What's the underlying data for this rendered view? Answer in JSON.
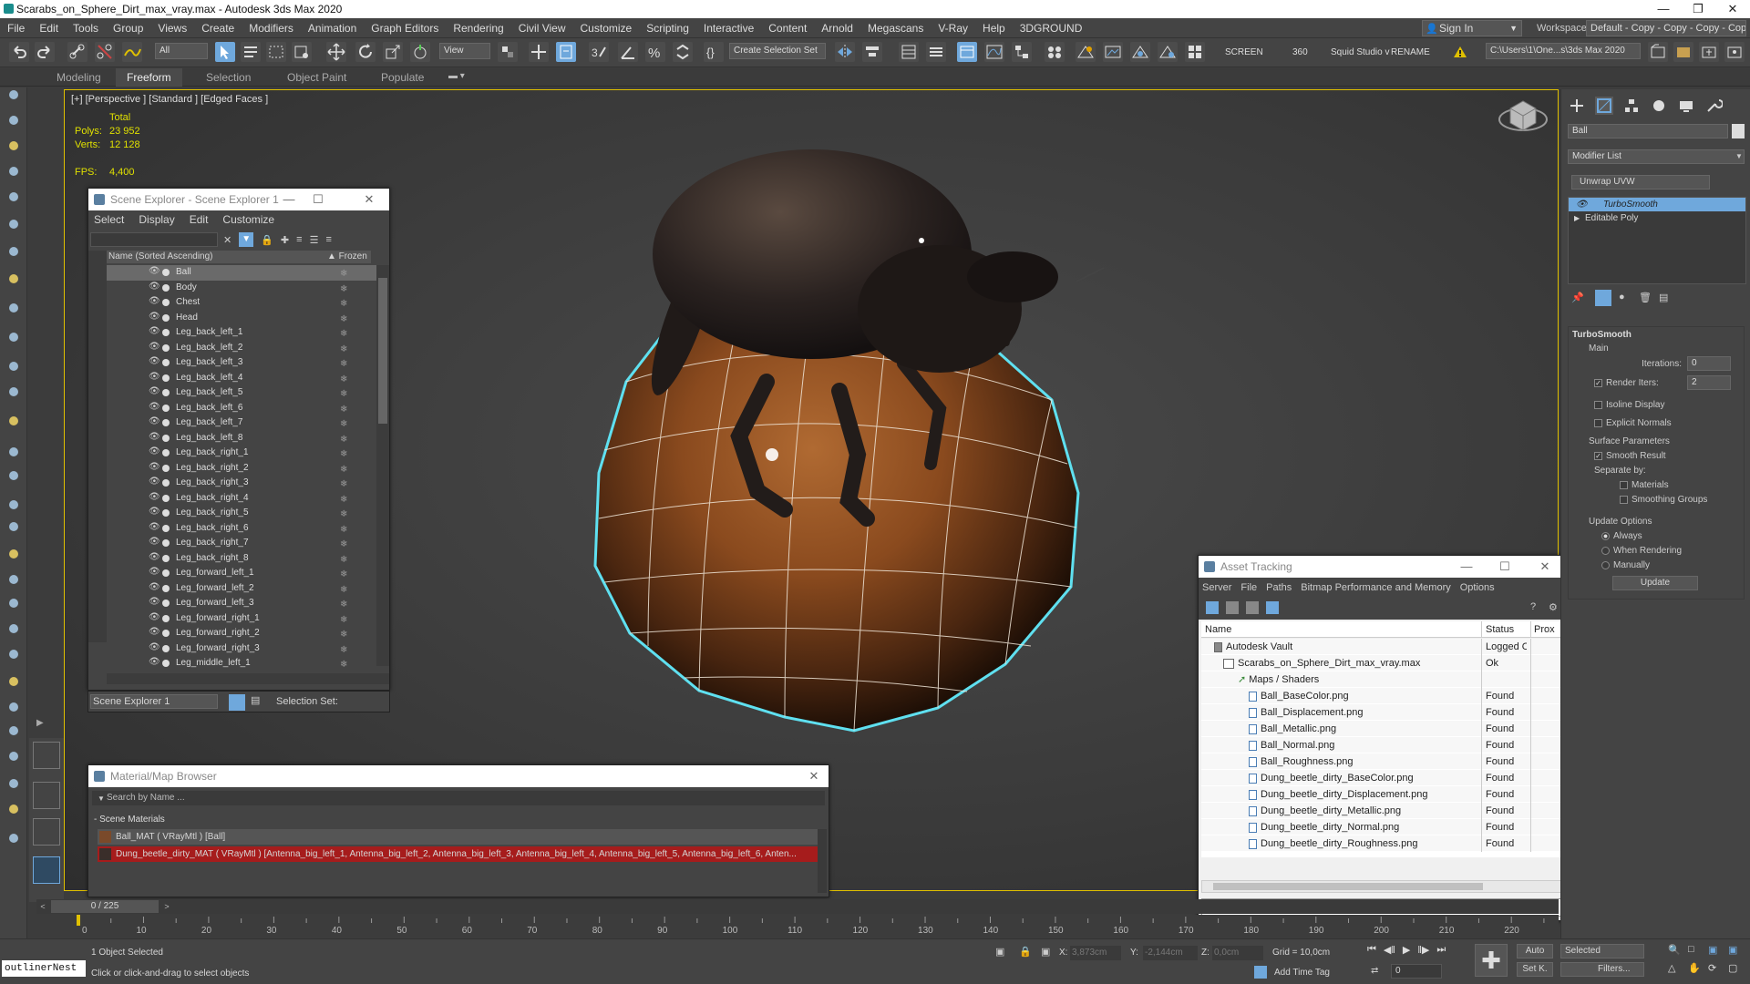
{
  "window": {
    "title": "Scarabs_on_Sphere_Dirt_max_vray.max - Autodesk 3ds Max 2020"
  },
  "menu": [
    "File",
    "Edit",
    "Tools",
    "Group",
    "Views",
    "Create",
    "Modifiers",
    "Animation",
    "Graph Editors",
    "Rendering",
    "Civil View",
    "Customize",
    "Scripting",
    "Interactive",
    "Content",
    "Arnold",
    "Megascans",
    "V-Ray",
    "Help",
    "3DGROUND"
  ],
  "account": {
    "sign_in": "Sign In",
    "workspaces_label": "Workspaces:",
    "workspace_value": "Default - Copy - Copy - Copy - Copy"
  },
  "toolbar": {
    "filter": "All",
    "view": "View",
    "selection_set": "Create Selection Set",
    "screen": "SCREEN",
    "num360": "360",
    "squid": "Squid Studio v",
    "rename": "RENAME",
    "path": "C:\\Users\\1\\One...s\\3ds Max 2020"
  },
  "ribbon_tabs": [
    "Modeling",
    "Freeform",
    "Selection",
    "Object Paint",
    "Populate"
  ],
  "viewport": {
    "label": "[+] [Perspective ] [Standard ] [Edged Faces ]",
    "stats": {
      "total_label": "Total",
      "polys_label": "Polys:",
      "polys": "23 952",
      "verts_label": "Verts:",
      "verts": "12 128",
      "fps_label": "FPS:",
      "fps": "4,400"
    }
  },
  "scene_explorer": {
    "title": "Scene Explorer - Scene Explorer 1",
    "menu": [
      "Select",
      "Display",
      "Edit",
      "Customize"
    ],
    "col_name": "Name (Sorted Ascending)",
    "col_frozen": "▲ Frozen",
    "items": [
      "Ball",
      "Body",
      "Chest",
      "Head",
      "Leg_back_left_1",
      "Leg_back_left_2",
      "Leg_back_left_3",
      "Leg_back_left_4",
      "Leg_back_left_5",
      "Leg_back_left_6",
      "Leg_back_left_7",
      "Leg_back_left_8",
      "Leg_back_right_1",
      "Leg_back_right_2",
      "Leg_back_right_3",
      "Leg_back_right_4",
      "Leg_back_right_5",
      "Leg_back_right_6",
      "Leg_back_right_7",
      "Leg_back_right_8",
      "Leg_forward_left_1",
      "Leg_forward_left_2",
      "Leg_forward_left_3",
      "Leg_forward_right_1",
      "Leg_forward_right_2",
      "Leg_forward_right_3",
      "Leg_middle_left_1"
    ],
    "selected_item": "Ball",
    "footer_name": "Scene Explorer 1",
    "footer_selset": "Selection Set:"
  },
  "material_browser": {
    "title": "Material/Map Browser",
    "search_placeholder": "Search by Name ...",
    "section": "- Scene Materials",
    "materials": [
      "Ball_MAT  ( VRayMtl )  [Ball]",
      "Dung_beetle_dirty_MAT   ( VRayMtl )   [Antenna_big_left_1,  Antenna_big_left_2,  Antenna_big_left_3,  Antenna_big_left_4,  Antenna_big_left_5,  Antenna_big_left_6,  Anten..."
    ]
  },
  "asset_tracking": {
    "title": "Asset Tracking",
    "menu": [
      "Server",
      "File",
      "Paths",
      "Bitmap Performance and Memory",
      "Options"
    ],
    "columns": [
      "Name",
      "Status",
      "Prox"
    ],
    "rows": [
      {
        "name": "Autodesk Vault",
        "status": "Logged O..."
      },
      {
        "name": "Scarabs_on_Sphere_Dirt_max_vray.max",
        "status": "Ok"
      },
      {
        "name": "Maps / Shaders",
        "status": ""
      },
      {
        "name": "Ball_BaseColor.png",
        "status": "Found"
      },
      {
        "name": "Ball_Displacement.png",
        "status": "Found"
      },
      {
        "name": "Ball_Metallic.png",
        "status": "Found"
      },
      {
        "name": "Ball_Normal.png",
        "status": "Found"
      },
      {
        "name": "Ball_Roughness.png",
        "status": "Found"
      },
      {
        "name": "Dung_beetle_dirty_BaseColor.png",
        "status": "Found"
      },
      {
        "name": "Dung_beetle_dirty_Displacement.png",
        "status": "Found"
      },
      {
        "name": "Dung_beetle_dirty_Metallic.png",
        "status": "Found"
      },
      {
        "name": "Dung_beetle_dirty_Normal.png",
        "status": "Found"
      },
      {
        "name": "Dung_beetle_dirty_Roughness.png",
        "status": "Found"
      }
    ]
  },
  "command_panel": {
    "object_name": "Ball",
    "modifier_list": "Modifier List",
    "unwrap": "Unwrap UVW",
    "stack": [
      "TurboSmooth",
      "Editable Poly"
    ],
    "rollout": "TurboSmooth",
    "main": "Main",
    "iterations_label": "Iterations:",
    "iterations": "0",
    "render_iters_label": "Render Iters:",
    "render_iters": "2",
    "isoline": "Isoline Display",
    "explicit_normals": "Explicit Normals",
    "surface_params": "Surface Parameters",
    "smooth_result": "Smooth Result",
    "separate_by": "Separate by:",
    "materials": "Materials",
    "smoothing_groups": "Smoothing Groups",
    "update_options": "Update Options",
    "always": "Always",
    "when_rendering": "When Rendering",
    "manually": "Manually",
    "update": "Update"
  },
  "timeline": {
    "frame": "0 / 225",
    "ticks": [
      "0",
      "10",
      "20",
      "30",
      "40",
      "50",
      "60",
      "70",
      "80",
      "90",
      "100",
      "110",
      "120",
      "130",
      "140",
      "150",
      "160",
      "170",
      "180",
      "190",
      "200",
      "210",
      "220"
    ]
  },
  "status": {
    "maxscript": "outlinerNest",
    "selected": "1 Object Selected",
    "prompt": "Click or click-and-drag to select objects",
    "x_label": "X:",
    "x": "3,873cm",
    "y_label": "Y:",
    "y": "-2,144cm",
    "z_label": "Z:",
    "z": "0,0cm",
    "grid": "Grid = 10,0cm",
    "add_time_tag": "Add Time Tag",
    "auto": "Auto",
    "selected_dd": "Selected",
    "set_k": "Set K.",
    "filters": "Filters...",
    "frame_field": "0"
  }
}
